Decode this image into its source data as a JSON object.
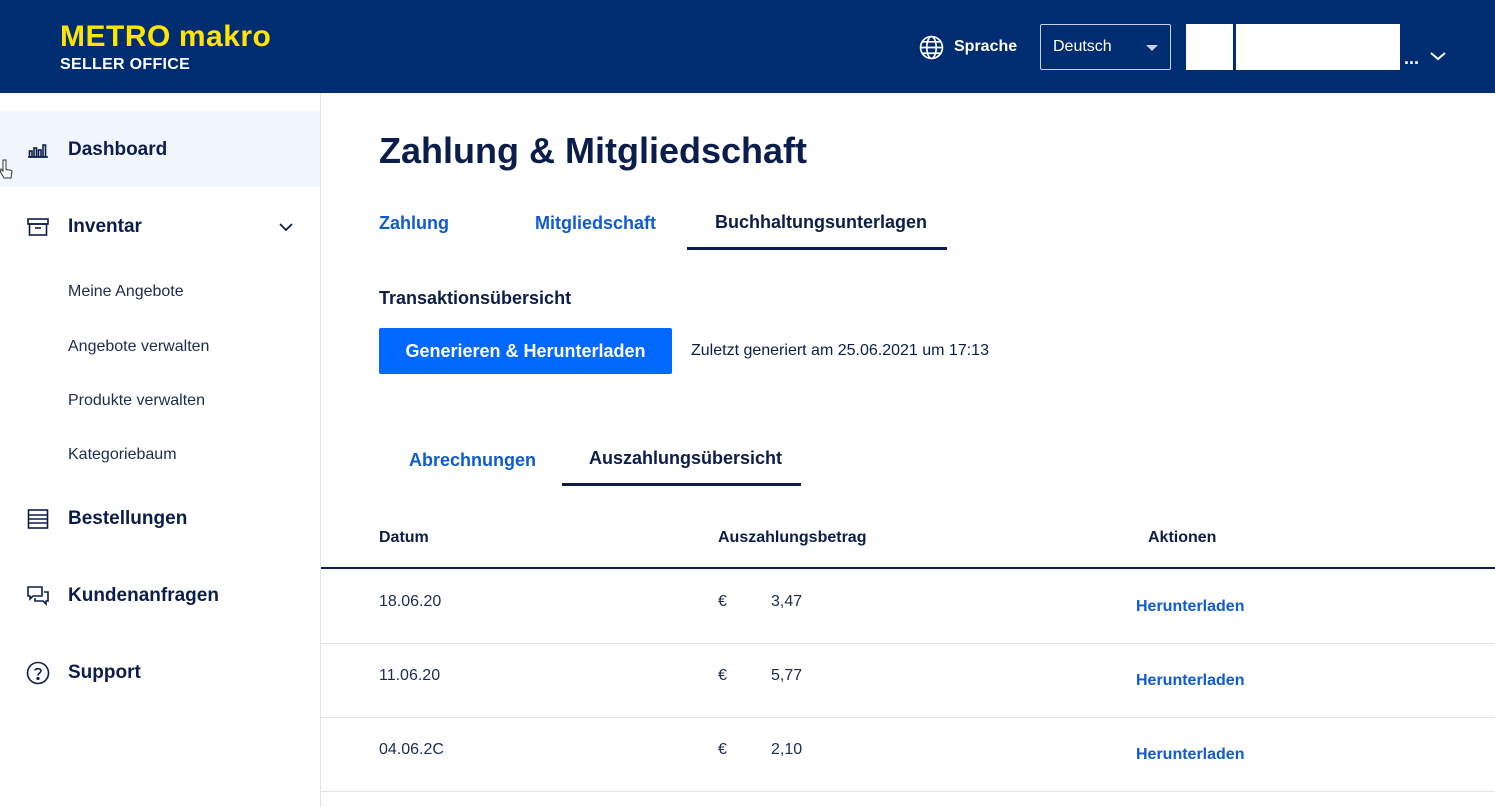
{
  "header": {
    "logo_brand": "METRO",
    "logo_brand2": "makro",
    "logo_sub": "SELLER OFFICE",
    "language_label": "Sprache",
    "language_value": "Deutsch",
    "user_ellipsis": "...",
    "icons": {
      "language": "globe-icon",
      "user_menu": "chevron-down-icon"
    },
    "colors": {
      "bg": "#002d72",
      "logo": "#ffe500"
    }
  },
  "sidebar": {
    "dashboard": "Dashboard",
    "inventar": "Inventar",
    "sub_items": [
      "Meine Angebote",
      "Angebote verwalten",
      "Produkte verwalten",
      "Kategoriebaum"
    ],
    "bestellungen": "Bestellungen",
    "kundenanfragen": "Kundenanfragen",
    "support": "Support"
  },
  "main": {
    "title": "Zahlung & Mitgliedschaft",
    "tabs": [
      "Zahlung",
      "Mitgliedschaft",
      "Buchhaltungsunterlagen"
    ],
    "active_tab": "Buchhaltungsunterlagen",
    "section_title": "Transaktionsübersicht",
    "generate_button": "Generieren & Herunterladen",
    "generate_note": "Zuletzt generiert am 25.06.2021 um 17:13",
    "subtabs": [
      "Abrechnungen",
      "Auszahlungsübersicht"
    ],
    "active_subtab": "Auszahlungsübersicht",
    "table": {
      "headers": [
        "Datum",
        "Auszahlungsbetrag",
        "Aktionen"
      ],
      "rows": [
        {
          "date": "18.06.20",
          "currency": "€",
          "amount": "3,47",
          "action": "Herunterladen"
        },
        {
          "date": "11.06.20",
          "currency": "€",
          "amount": "5,77",
          "action": "Herunterladen"
        },
        {
          "date": "04.06.2C",
          "currency": "€",
          "amount": "2,10",
          "action": "Herunterladen"
        }
      ]
    },
    "colors": {
      "primary_button": "#0067ff",
      "link": "#0f5bd1",
      "text": "#0b1e4b"
    }
  }
}
